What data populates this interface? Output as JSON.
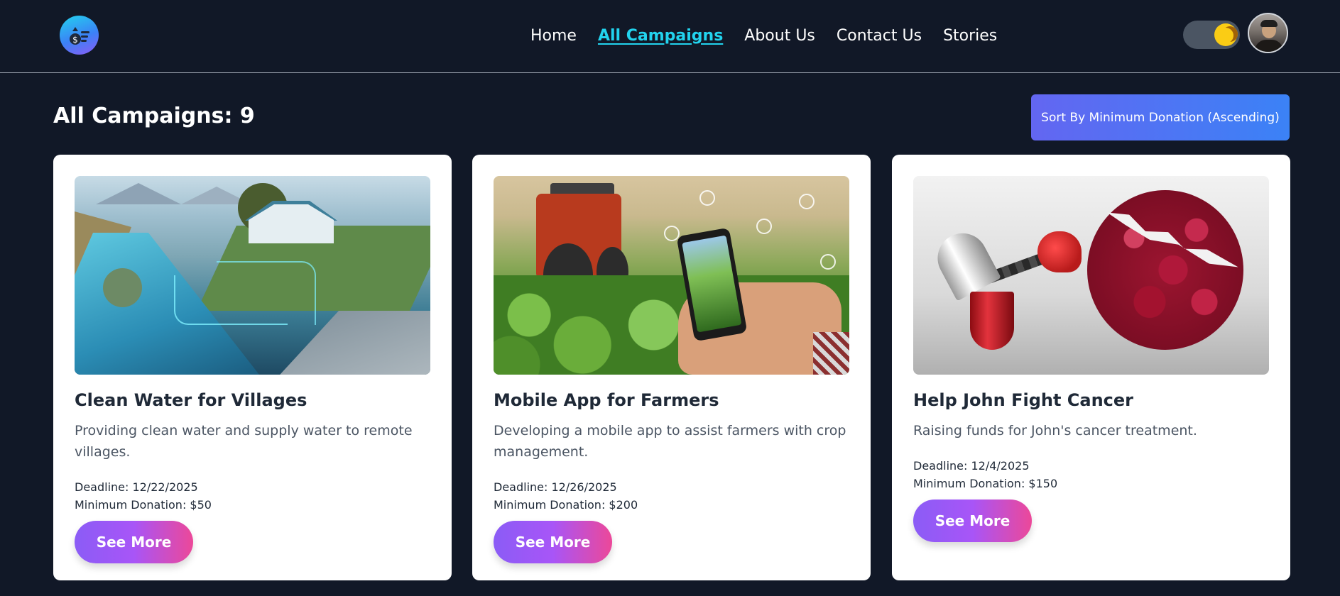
{
  "nav": {
    "links": [
      {
        "label": "Home",
        "active": false
      },
      {
        "label": "All Campaigns",
        "active": true
      },
      {
        "label": "About Us",
        "active": false
      },
      {
        "label": "Contact Us",
        "active": false
      },
      {
        "label": "Stories",
        "active": false
      }
    ],
    "theme_toggle_state": "dark",
    "colors": {
      "background": "#111827",
      "active_link": "#22d3ee"
    }
  },
  "page": {
    "title": "All Campaigns: 9",
    "sort_button_label": "Sort By Minimum Donation (Ascending)"
  },
  "campaigns": [
    {
      "title": "Clean Water for Villages",
      "description": "Providing clean water and supply water to remote villages.",
      "deadline": "Deadline: 12/22/2025",
      "min_donation": "Minimum Donation: $50",
      "button_label": "See More"
    },
    {
      "title": "Mobile App for Farmers",
      "description": "Developing a mobile app to assist farmers with crop management.",
      "deadline": "Deadline: 12/26/2025",
      "min_donation": "Minimum Donation: $200",
      "button_label": "See More"
    },
    {
      "title": "Help John Fight Cancer",
      "description": "Raising funds for John's cancer treatment.",
      "deadline": "Deadline: 12/4/2025",
      "min_donation": "Minimum Donation: $150",
      "button_label": "See More"
    }
  ]
}
